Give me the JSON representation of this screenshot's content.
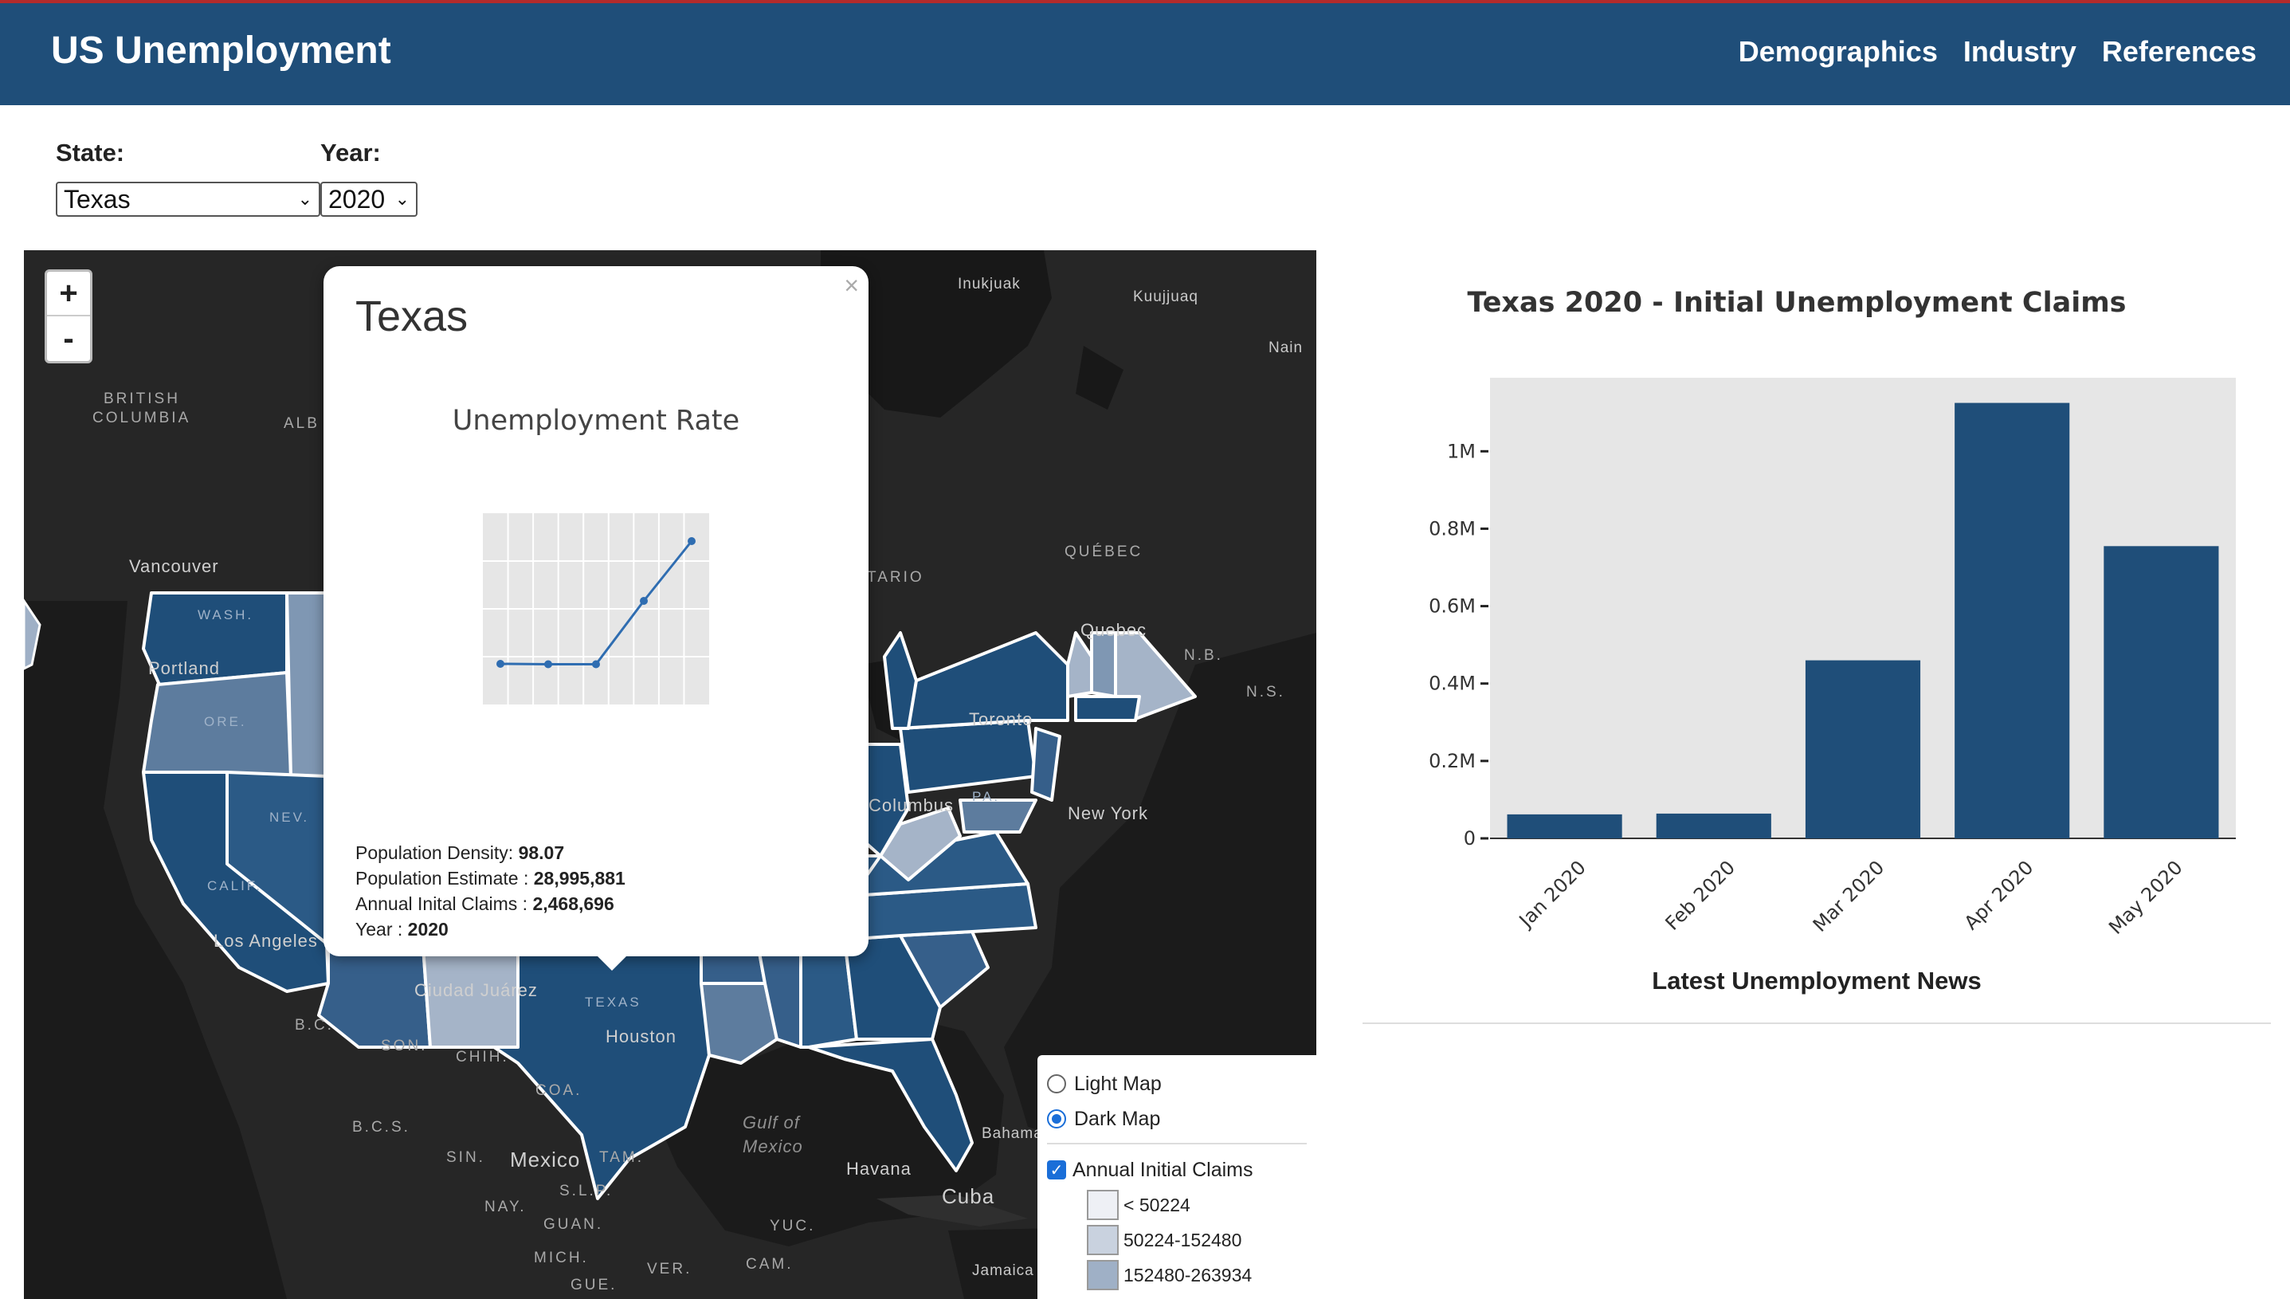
{
  "nav": {
    "brand": "US Unemployment",
    "links": [
      "Demographics",
      "Industry",
      "References"
    ]
  },
  "filters": {
    "state_label": "State:",
    "state_value": "Texas",
    "year_label": "Year:",
    "year_value": "2020"
  },
  "map": {
    "zoom_in": "+",
    "zoom_out": "-",
    "labels": {
      "british_columbia_1": "BRITISH",
      "british_columbia_2": "COLUMBIA",
      "alb": "ALB",
      "vancouver": "Vancouver",
      "inukjuak": "Inukjuak",
      "kuujjuaq": "Kuujjuaq",
      "nain": "Nain",
      "quebec_prov": "QUÉBEC",
      "quebec_city": "Quebec",
      "tario": "TARIO",
      "toronto": "Toronto",
      "new_york": "New York",
      "nb": "N.B.",
      "ns": "N.S.",
      "wash": "WASH.",
      "ore": "ORE.",
      "nev": "NEV.",
      "calif": "CALIF.",
      "los_angeles": "Los Angeles",
      "portland": "Portland",
      "texas": "TEXAS",
      "houston": "Houston",
      "ciudad_juarez": "Ciudad Juárez",
      "son": "SON.",
      "chih": "CHIH.",
      "coa": "COA.",
      "bc": "B.C.",
      "bcs": "B.C.S.",
      "sin": "SIN.",
      "mexico": "Mexico",
      "tam": "TAM.",
      "slp": "S.L.P.",
      "nay": "NAY.",
      "guan": "GUAN.",
      "mich": "MICH.",
      "gue": "GUE.",
      "ver": "VER.",
      "yuc": "YUC.",
      "cam": "CAM.",
      "gulf_1": "Gulf of",
      "gulf_2": "Mexico",
      "havana": "Havana",
      "cuba": "Cuba",
      "bahamas": "Bahama",
      "jamaica": "Jamaica",
      "columbus": "Columbus",
      "pa": "PA."
    }
  },
  "popup": {
    "close": "×",
    "title": "Texas",
    "subtitle": "Unemployment Rate",
    "density_label": "Population Density: ",
    "density_value": "98.07",
    "pop_label": "Population Estimate : ",
    "pop_value": "28,995,881",
    "claims_label": "Annual Inital Claims : ",
    "claims_value": "2,468,696",
    "year_label": "Year : ",
    "year_value": "2020",
    "sparkline_values": [
      0.62,
      0.61,
      0.61,
      2.2,
      3.7
    ]
  },
  "layer_control": {
    "light_map": "Light Map",
    "dark_map": "Dark Map",
    "selected_base": "Dark Map",
    "overlay": "Annual Initial Claims",
    "overlay_checked": true,
    "legend": [
      {
        "label": "< 50224",
        "color": "#eef0f5"
      },
      {
        "label": "50224-152480",
        "color": "#c9d2df"
      },
      {
        "label": "152480-263934",
        "color": "#9fb0c6"
      }
    ]
  },
  "chart_data": {
    "type": "bar",
    "title": "Texas 2020 - Initial Unemployment Claims",
    "categories": [
      "Jan 2020",
      "Feb 2020",
      "Mar 2020",
      "Apr 2020",
      "May 2020"
    ],
    "values": [
      62000,
      64000,
      460000,
      1125000,
      755000
    ],
    "ylim": [
      0,
      1190000
    ],
    "yticks": [
      0,
      200000,
      400000,
      600000,
      800000,
      1000000
    ],
    "ytick_labels": [
      "0",
      "0.2M",
      "0.4M",
      "0.6M",
      "0.8M",
      "1M"
    ],
    "bar_color": "#1f4e79",
    "plot_bg": "#e6e6e6",
    "grid": false
  },
  "news": {
    "title": "Latest Unemployment News"
  }
}
